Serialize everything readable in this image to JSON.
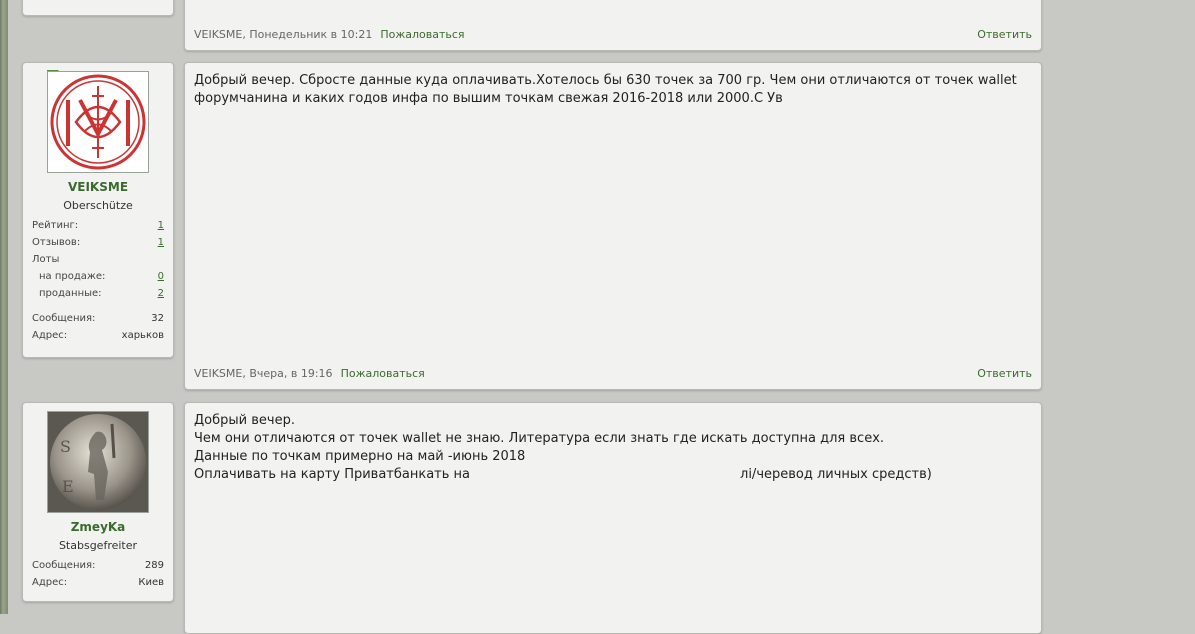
{
  "posts": [
    {
      "author_line": "VEIKSME, Понедельник в 10:21",
      "report_label": "Пожаловаться",
      "reply_label": "Ответить"
    },
    {
      "user": {
        "name": "VEIKSME",
        "title": "Oberschütze",
        "rating_label": "Рейтинг:",
        "rating_value": "1",
        "reviews_label": "Отзывов:",
        "reviews_value": "1",
        "lots_label": "Лоты",
        "on_sale_label": "на продаже:",
        "on_sale_value": "0",
        "sold_label": "проданные:",
        "sold_value": "2",
        "messages_label": "Сообщения:",
        "messages_value": "32",
        "address_label": "Адрес:",
        "address_value": "харьков"
      },
      "body": [
        "Добрый вечер. Сбросте данные куда оплачивать.Хотелось бы 630 точек за 700 гр. Чем они отличаются от точек wallet форумчанина и каких годов инфа по вышим точкам свежая 2016-2018 или 2000.С Ув"
      ],
      "author_line": "VEIKSME, Вчера, в 19:16",
      "report_label": "Пожаловаться",
      "reply_label": "Ответить"
    },
    {
      "user": {
        "name": "ZmeyKa",
        "title": "Stabsgefreiter",
        "messages_label": "Сообщения:",
        "messages_value": "289",
        "address_label": "Адрес:",
        "address_value": "Киев"
      },
      "body": [
        "Добрый вечер.",
        "Чем они отличаются от точек wallet не знаю. Литература если знать где искать доступна для всех.",
        "Данные по точкам примерно на май -июнь 2018"
      ],
      "payment_line_start": "Оплачивать на карту Приватбанкать на",
      "payment_line_end": "лі/черевод личных средств)"
    }
  ],
  "colors": {
    "accent": "#3a6b2e",
    "background": "#c8c8c4",
    "panel": "#f2f2f0"
  },
  "icons": {
    "veiksme_avatar": "monogram-avatar-icon",
    "zmeyka_avatar": "coin-avatar-icon"
  }
}
